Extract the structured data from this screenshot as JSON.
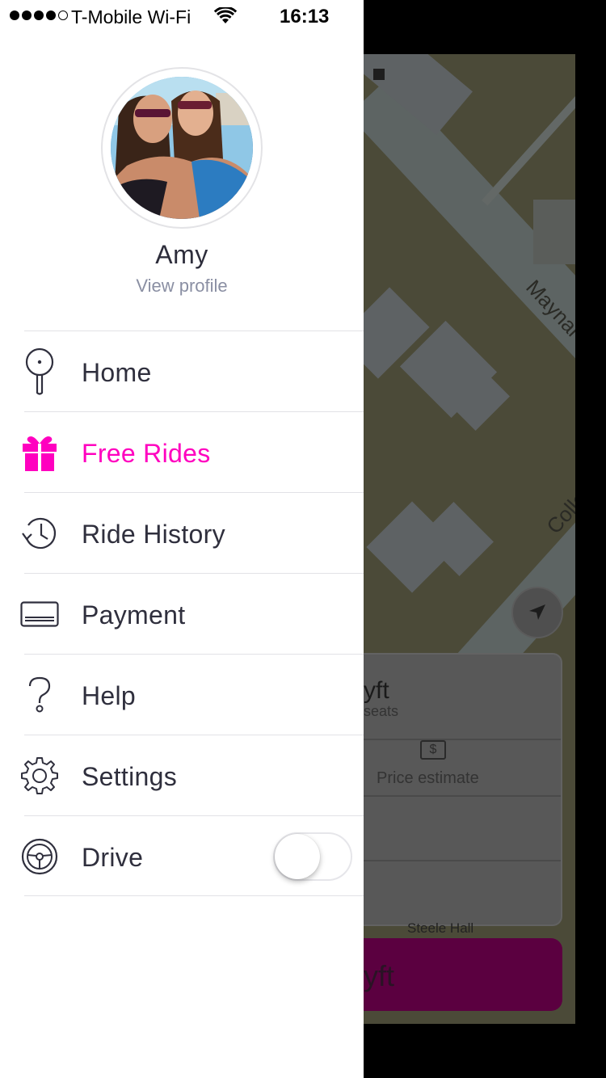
{
  "status_bar": {
    "carrier": "T-Mobile Wi-Fi",
    "time": "16:13",
    "signal_bars_filled": 4,
    "signal_bars_total": 5
  },
  "profile": {
    "name": "Amy",
    "view_profile_label": "View profile"
  },
  "menu": {
    "items": [
      {
        "label": "Home",
        "icon": "map-pin-icon"
      },
      {
        "label": "Free Rides",
        "icon": "gift-icon",
        "active": true
      },
      {
        "label": "Ride History",
        "icon": "clock-history-icon"
      },
      {
        "label": "Payment",
        "icon": "credit-card-icon"
      },
      {
        "label": "Help",
        "icon": "question-icon"
      },
      {
        "label": "Settings",
        "icon": "gear-icon"
      },
      {
        "label": "Drive",
        "icon": "steering-wheel-icon",
        "toggle_on": false
      }
    ]
  },
  "background": {
    "map_labels": [
      "Maynar",
      "Colle"
    ],
    "ride_name_partial": "yft",
    "ride_seats_partial": "seats",
    "price_estimate_label": "Price estimate",
    "price_icon_symbol": "$",
    "destination_label": "Steele Hall",
    "request_button_partial": "yft"
  },
  "colors": {
    "accent": "#ff00bf",
    "menu_text": "#2f2f3d",
    "secondary_text": "#8a8fa3",
    "divider": "#e2e2e6"
  }
}
